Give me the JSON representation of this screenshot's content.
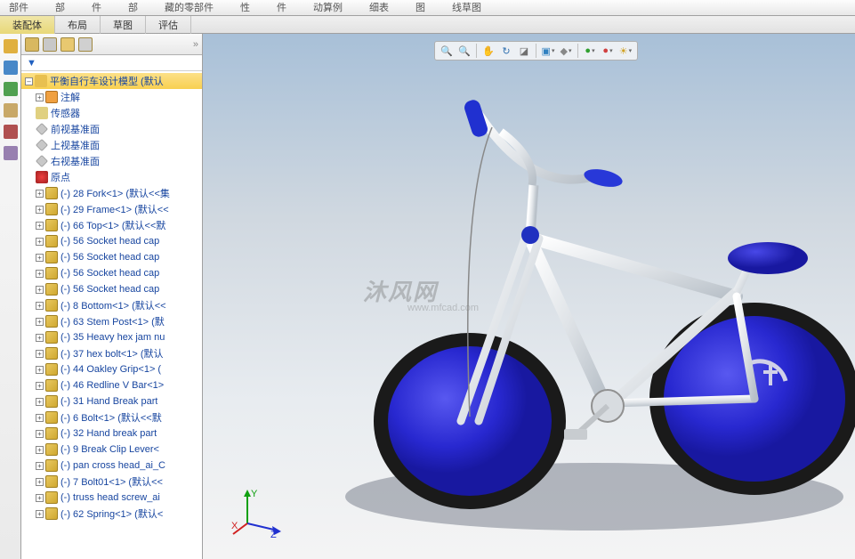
{
  "top_menu": [
    "部件",
    "部",
    "件",
    "部",
    "藏的零部件",
    "性",
    "件",
    "动算例",
    "细表",
    "图",
    "线草图"
  ],
  "ribbon_tabs": [
    "装配体",
    "布局",
    "草图",
    "评估"
  ],
  "active_ribbon_tab": 0,
  "tree_filter_label": "▼",
  "tree_root": "平衡自行车设计模型  (默认",
  "tree_fixed": [
    {
      "icon": "annot",
      "label": "注解"
    },
    {
      "icon": "sensor",
      "label": "传感器"
    },
    {
      "icon": "plane",
      "label": "前视基准面"
    },
    {
      "icon": "plane",
      "label": "上视基准面"
    },
    {
      "icon": "plane",
      "label": "右视基准面"
    },
    {
      "icon": "origin",
      "label": "原点"
    }
  ],
  "tree_parts": [
    "(-) 28 Fork<1> (默认<<集",
    "(-) 29 Frame<1> (默认<<",
    "(-) 66 Top<1> (默认<<默",
    "(-) 56 Socket head cap",
    "(-) 56 Socket head cap",
    "(-) 56 Socket head cap",
    "(-) 56 Socket head cap",
    "(-) 8 Bottom<1> (默认<<",
    "(-) 63 Stem Post<1> (默",
    "(-) 35 Heavy hex jam nu",
    "(-) 37 hex bolt<1> (默认",
    "(-) 44 Oakley Grip<1> (",
    "(-) 46 Redline V Bar<1>",
    "(-) 31 Hand Break part",
    "(-) 6 Bolt<1> (默认<<默",
    "(-) 32 Hand break part",
    "(-) 9 Break Clip Lever<",
    "(-) pan cross head_ai_C",
    "(-) 7 Bolt01<1> (默认<<",
    "(-) truss head screw_ai",
    "(-) 62 Spring<1> (默认<"
  ],
  "viewport_tools": [
    {
      "name": "zoom-fit-icon",
      "glyph": "🔍",
      "color": "#3070b0"
    },
    {
      "name": "zoom-area-icon",
      "glyph": "🔍",
      "color": "#3070b0"
    },
    {
      "name": "pan-icon",
      "glyph": "✋",
      "color": "#c08040"
    },
    {
      "name": "rotate-icon",
      "glyph": "↻",
      "color": "#3070b0"
    },
    {
      "name": "section-icon",
      "glyph": "◪",
      "color": "#707070"
    },
    {
      "name": "display-style-icon",
      "glyph": "▣",
      "color": "#3080c0"
    },
    {
      "name": "perspective-icon",
      "glyph": "◆",
      "color": "#888"
    },
    {
      "name": "scene-icon",
      "glyph": "●",
      "color": "#30a030"
    },
    {
      "name": "appearance-icon",
      "glyph": "●",
      "color": "#d04040"
    },
    {
      "name": "settings-icon",
      "glyph": "☀",
      "color": "#d0a020"
    }
  ],
  "watermark": "沐风网",
  "watermark_url": "www.mfcad.com",
  "triad_labels": {
    "x": "X",
    "y": "Y",
    "z": "Z"
  }
}
